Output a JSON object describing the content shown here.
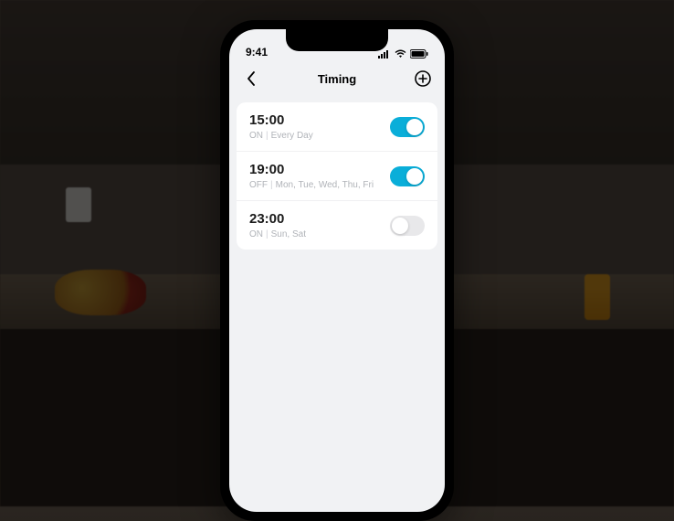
{
  "status_bar": {
    "time": "9:41"
  },
  "header": {
    "title": "Timing"
  },
  "timers": [
    {
      "time": "15:00",
      "action": "ON",
      "days": "Every Day",
      "enabled": true
    },
    {
      "time": "19:00",
      "action": "OFF",
      "days": "Mon, Tue, Wed, Thu, Fri",
      "enabled": true
    },
    {
      "time": "23:00",
      "action": "ON",
      "days": "Sun, Sat",
      "enabled": false
    }
  ],
  "colors": {
    "toggle_on": "#0aaed9",
    "toggle_off": "#e8e8ea"
  }
}
